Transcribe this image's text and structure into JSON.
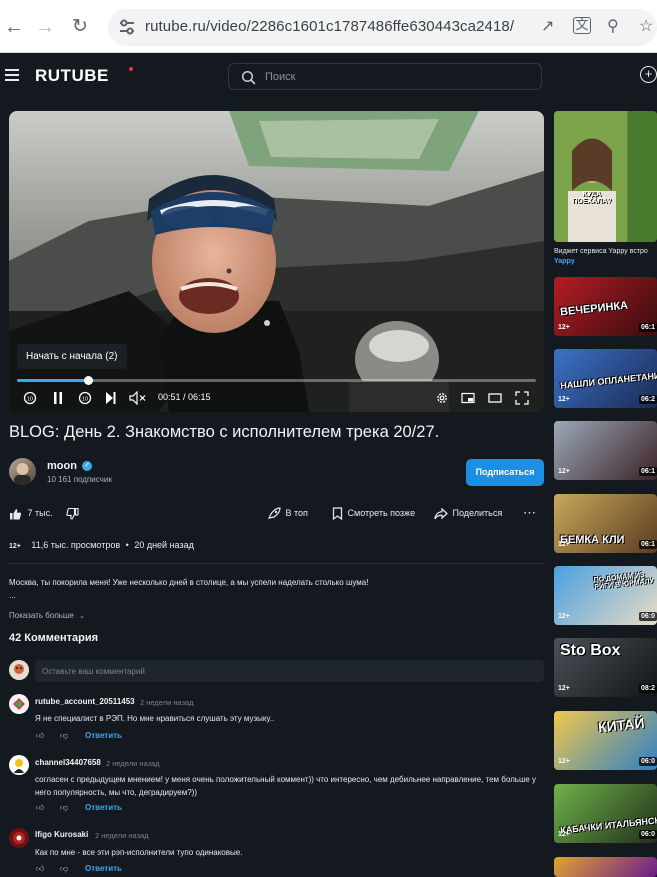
{
  "browser": {
    "url": "rutube.ru/video/2286c1601c1787486ffe630443ca2418/",
    "icons": [
      "back-icon",
      "forward-icon",
      "reload-icon",
      "site-settings-icon",
      "open-external-icon",
      "translate-icon",
      "zoom-icon",
      "bookmark-star-icon"
    ]
  },
  "header": {
    "logo": "RUTUBE",
    "search_placeholder": "Поиск",
    "colors": {
      "background": "#14191f",
      "logo_dot": "#ef3340",
      "accent": "#1a8fe3"
    }
  },
  "player": {
    "tooltip": "Начать с начала (2)",
    "timecode": "00:51 / 06:15",
    "progress": 0.136,
    "controls": [
      "rewind-10-icon",
      "pause-icon",
      "forward-10-icon",
      "next-icon",
      "mute-icon",
      "settings-icon",
      "mini-player-icon",
      "theater-icon",
      "fullscreen-icon"
    ]
  },
  "video": {
    "title": "BLOG: День 2. Знакомство с исполнителем трека 20/27.",
    "channel_name": "moon",
    "subscribers": "10 161 подписчик",
    "subscribe_label": "Подписаться",
    "likes": "7 тыс.",
    "to_top_label": "В топ",
    "watch_later_label": "Смотреть позже",
    "share_label": "Поделиться",
    "age_rating": "12+",
    "views": "11,6 тыс. просмотров",
    "separator": "•",
    "date": "20 дней назад",
    "description": "Москва, ты покорила меня! Уже несколько дней в столице, а мы успели наделать столько шума!",
    "description_ellipsis": "...",
    "show_more": "Показать больше"
  },
  "comments": {
    "count_label": "42 Комментария",
    "input_placeholder": "Оставьте ваш комментарий",
    "items": [
      {
        "author": "rutube_account_20511453",
        "time": "2 недели назад",
        "text": "Я не специалист в РЭП. Но мне нравиться слушать эту музыку..",
        "reply": "Ответить"
      },
      {
        "author": "channel34407658",
        "time": "2 недели назад",
        "text": "согласен с предыдущем мнением! у меня очень положительный коммент)) что интересно, чем дебильнее направление, тем больше у него популярность, мы что, деградируем?))",
        "reply": "Ответить"
      },
      {
        "author": "Ifigo Kurosaki",
        "time": "2 недели назад",
        "text": "Как по мне - все эти рэп-исполнители тупо одинаковые.",
        "reply": "Ответить"
      }
    ]
  },
  "sidebar": {
    "widget_caption": "Виджет сервиса Yappy встро",
    "widget_source": "Yappy",
    "widget_overlay": "КУДА ПОЕХАЛА?",
    "videos": [
      {
        "age": "12+",
        "duration": "06:1",
        "caption": "ВЕЧЕРИНКА"
      },
      {
        "age": "12+",
        "duration": "06:2",
        "caption": "НАШЛИ ОПЛАНЕТАНИНА"
      },
      {
        "age": "12+",
        "duration": "06:1",
        "caption": ""
      },
      {
        "age": "12+",
        "duration": "06:1",
        "caption": "БЕМКА КЛИ"
      },
      {
        "age": "12+",
        "duration": "06:0",
        "caption": "ПО ДОМАМ ИЗ РИГИ В ЮРМАЛУ"
      },
      {
        "age": "12+",
        "duration": "08:2",
        "caption": "Sto Box"
      },
      {
        "age": "12+",
        "duration": "06:0",
        "caption": "КИТАЙ"
      },
      {
        "age": "12+",
        "duration": "06:0",
        "caption": "КАБАЧКИ ИТАЛЬЯНСКИ"
      }
    ]
  }
}
